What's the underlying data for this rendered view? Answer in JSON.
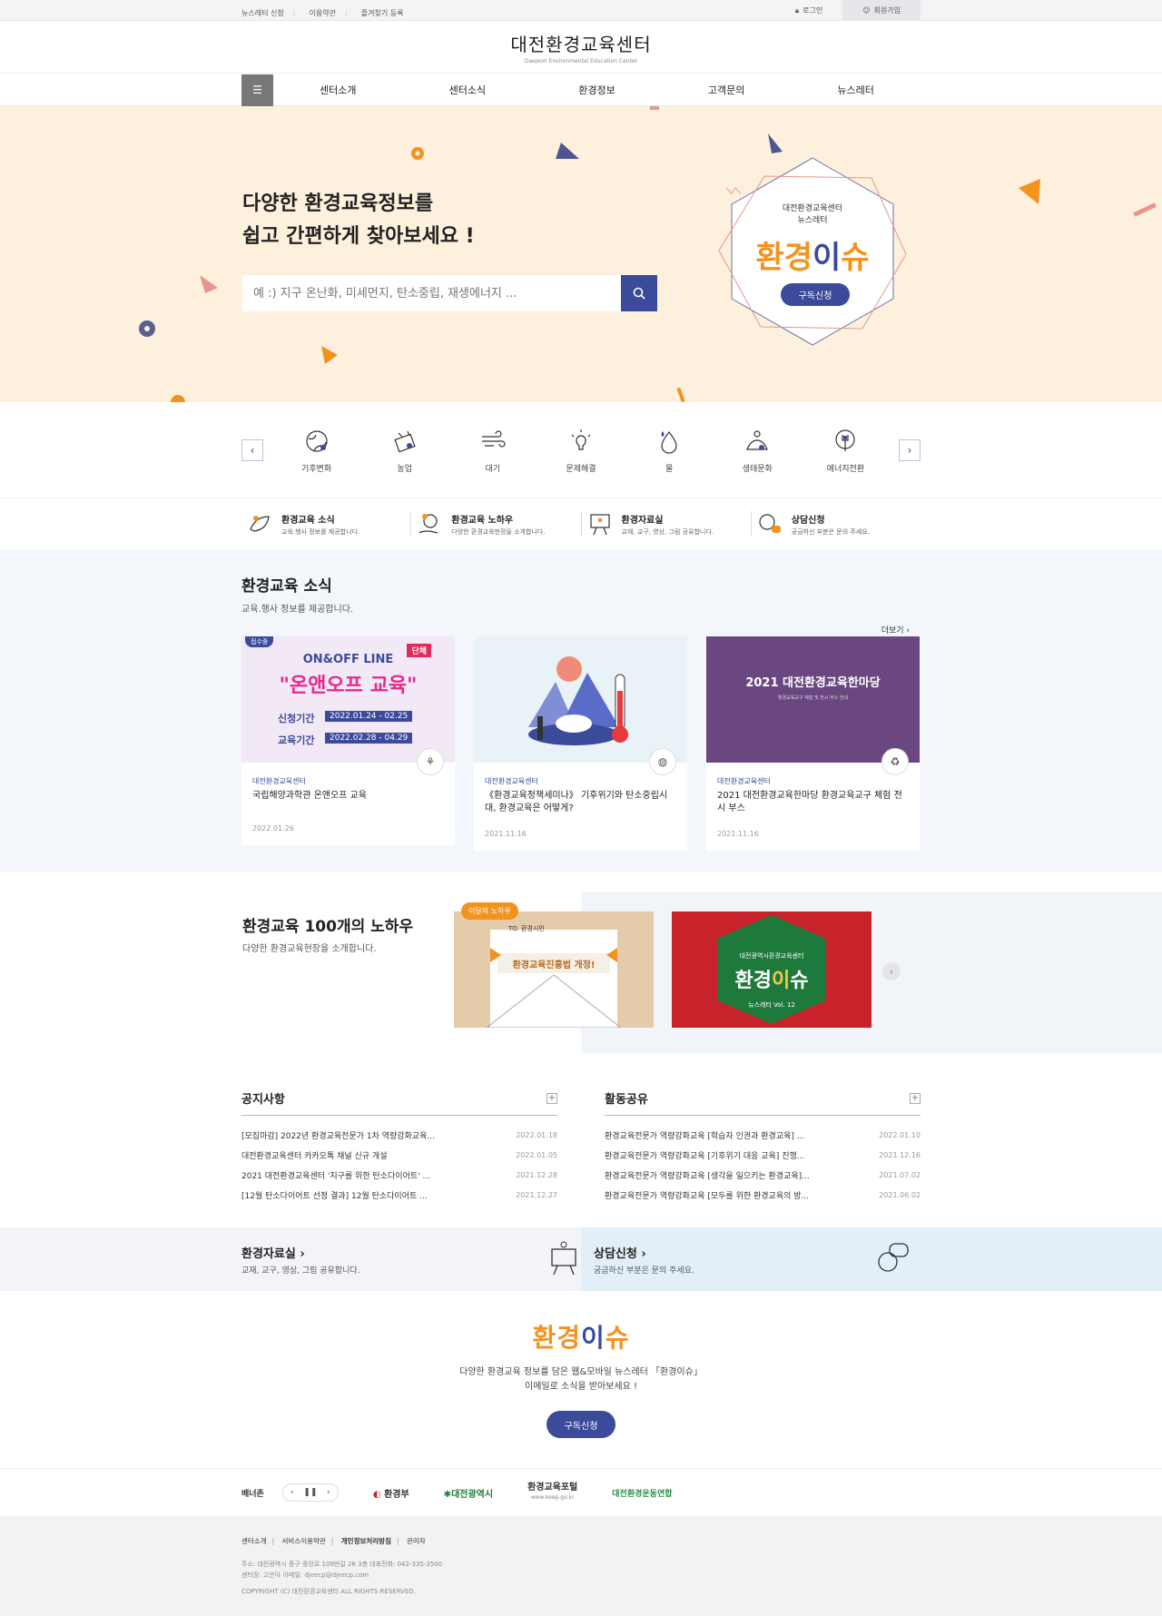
{
  "topbar": {
    "links": [
      "뉴스레터 신청",
      "이용약관",
      "즐겨찾기 등록"
    ],
    "login": "로그인",
    "join": "회원가입"
  },
  "header": {
    "logo": "대전환경교육센터",
    "logo_sub": "Daejeon Environmental Education Center"
  },
  "gnb": {
    "items": [
      "센터소개",
      "센터소식",
      "환경정보",
      "고객문의",
      "뉴스레터"
    ]
  },
  "hero": {
    "line1": "다양한 환경교육정보를",
    "line2": "쉽고 간편하게 찾아보세요 !",
    "placeholder": "예 :) 지구 온난화, 미세먼지, 탄소중립, 재생에너지 ...",
    "badge_org": "대전환경교육센터",
    "badge_sub": "뉴스레터",
    "badge_title_a": "환경",
    "badge_title_b": "이",
    "badge_title_c": "슈",
    "badge_btn": "구독신청"
  },
  "categories": [
    {
      "label": "기후변화",
      "icon": "globe-icon"
    },
    {
      "label": "농업",
      "icon": "farm-icon"
    },
    {
      "label": "대기",
      "icon": "wind-icon"
    },
    {
      "label": "문제해결",
      "icon": "lightbulb-icon"
    },
    {
      "label": "물",
      "icon": "water-drop-icon"
    },
    {
      "label": "생태문화",
      "icon": "ecology-icon"
    },
    {
      "label": "에너지전환",
      "icon": "energy-icon"
    }
  ],
  "quick": [
    {
      "title": "환경교육 소식",
      "desc": "교육.행사 정보를 제공합니다."
    },
    {
      "title": "환경교육 노하우",
      "desc": "다양한 환경교육현장을 소개합니다."
    },
    {
      "title": "환경자료실",
      "desc": "교재, 교구, 영상, 그림 공유합니다."
    },
    {
      "title": "상담신청",
      "desc": "궁금하신 부분은 문의 주세요."
    }
  ],
  "news": {
    "title": "환경교육 소식",
    "desc": "교육.행사 정보를 제공합니다.",
    "more": "더보기 ›",
    "cards": [
      {
        "org": "대전환경교육센터",
        "title": "국립해양과학관 온앤오프 교육",
        "date": "2022.01.26",
        "img_tag": "접수중",
        "img_l1": "ON&OFF LINE",
        "img_l2": "\"온앤오프 교육\"",
        "img_group": "단체",
        "img_p1": "신청기간",
        "img_d1": "2022.01.24 - 02.25",
        "img_p2": "교육기간",
        "img_d2": "2022.02.28 - 04.29"
      },
      {
        "org": "대전환경교육센터",
        "title": "《환경교육정책세미나》 기후위기와 탄소중립시대, 환경교육은 어떻게?",
        "date": "2021.11.16"
      },
      {
        "org": "대전환경교육센터",
        "title": "2021 대전환경교육한마당 환경교육교구 체험 전시 부스",
        "date": "2021.11.16",
        "img_title": "2021 대전환경교육한마당",
        "img_sub": "환경교육교구 체험 및 전시 부스 안내"
      }
    ]
  },
  "knowhow": {
    "title": "환경교육 100개의 노하우",
    "desc": "다양한 환경교육현장을 소개합니다.",
    "badge": "이달의 노하우",
    "card1_to": "TO. 환경시민",
    "card1_text": "환경교육진흥법 개정!",
    "card2_org": "대전광역시환경교육센터",
    "card2_a": "환경",
    "card2_b": "이",
    "card2_c": "슈",
    "card2_vol": "뉴스레터 Vol. 12"
  },
  "notice": {
    "title": "공지사항",
    "items": [
      {
        "text": "[모집마감] 2022년 환경교육전문가 1차 역량강화교육...",
        "date": "2022.01.18"
      },
      {
        "text": "대전환경교육센터 카카오톡 채널 신규 개설",
        "date": "2022.01.05"
      },
      {
        "text": "2021 대전환경교육센터 '지구를 위한 탄소다이어트' ...",
        "date": "2021.12.28"
      },
      {
        "text": "[12월 탄소다이어트 선정 결과] 12월 탄소다이어트 ...",
        "date": "2021.12.27"
      }
    ]
  },
  "activity": {
    "title": "활동공유",
    "items": [
      {
        "text": "환경교육전문가 역량강화교육 [학습자 인권과 환경교육] ...",
        "date": "2022.01.10"
      },
      {
        "text": "환경교육전문가 역량강화교육 [기후위기 대응 교육] 진행...",
        "date": "2021.12.16"
      },
      {
        "text": "환경교육전문가 역량강화교육 [생각을 일으키는 환경교육]...",
        "date": "2021.07.02"
      },
      {
        "text": "환경교육전문가 역량강화교육 [모두를 위한 환경교육의 방...",
        "date": "2021.06.02"
      }
    ]
  },
  "twin": {
    "left_title": "환경자료실  ›",
    "left_desc": "교재, 교구, 영상, 그림 공유합니다.",
    "right_title": "상담신청  ›",
    "right_desc": "궁금하신 부분은 문의 주세요."
  },
  "subscribe": {
    "brand_a": "환경",
    "brand_b": "이",
    "brand_c": "슈",
    "line1": "다양한 환경교육 정보를 담은 웹&모바일 뉴스레터 「환경이슈」",
    "line2": "이메일로 소식을 받아보세요 !",
    "btn": "구독신청"
  },
  "banner": {
    "label": "배너존",
    "logos": [
      "환경부",
      "대전광역시",
      "환경교육포털",
      "대전환경운동연합"
    ],
    "portal_url": "www.keep.go.kr"
  },
  "footer": {
    "links": [
      "센터소개",
      "서비스이용약관",
      "개인정보처리방침",
      "관리자"
    ],
    "addr": "주소: 대전광역시 중구 중앙로 109번길 26 3층    대표전화: 042-335-3500",
    "manager": "센터장: 고은아    이메일: djeecp@djeecp.com",
    "copy": "COPYRIGHT (C) 대전환경교육센터 ALL RIGHTS RESERVED."
  },
  "colors": {
    "accent": "#3b4a9a",
    "orange": "#f29320",
    "hero_bg": "#fdf1dd"
  }
}
